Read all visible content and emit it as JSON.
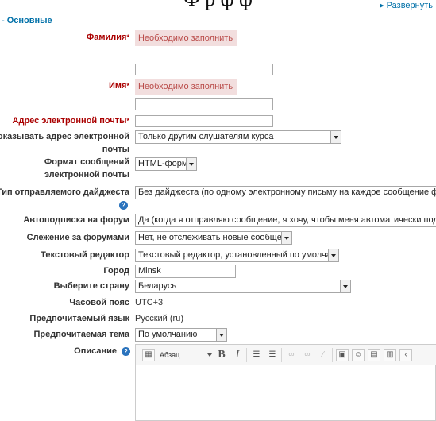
{
  "header": {
    "top_clip": "Ф р ф ф",
    "expand_link": "▸ Развернуть"
  },
  "section": {
    "legend": "- Основные"
  },
  "form": {
    "lastname": {
      "label": "Фамилия",
      "error": "Необходимо заполнить",
      "value": ""
    },
    "firstname": {
      "label": "Имя",
      "error": "Необходимо заполнить",
      "value": ""
    },
    "email": {
      "label": "Адрес электронной почты",
      "value": ""
    },
    "maildisplay": {
      "label_line1": "Показывать адрес электронной",
      "label_line2": "почты",
      "value": "Только другим слушателям курса"
    },
    "mailformat": {
      "label_line1": "Формат сообщений",
      "label_line2": "электронной почты",
      "value": "HTML-формат"
    },
    "maildigest": {
      "label": "Тип отправляемого дайджеста",
      "value": "Без дайджеста (по одному электронному письму на каждое сообщение форума)"
    },
    "autosubscribe": {
      "label": "Автоподписка на форум",
      "value": "Да (когда я отправляю сообщение, я хочу, чтобы меня автоматически подписывали"
    },
    "trackforums": {
      "label": "Слежение за форумами",
      "value": "Нет, не отслеживать новые сообщения"
    },
    "preference_htmleditor": {
      "label": "Текстовый редактор",
      "value": "Текстовый редактор, установленный по умолчанию"
    },
    "city": {
      "label": "Город",
      "value": "Minsk"
    },
    "country": {
      "label": "Выберите страну",
      "value": "Беларусь"
    },
    "timezone": {
      "label": "Часовой пояс",
      "value": "UTC+3"
    },
    "lang": {
      "label": "Предпочитаемый язык",
      "value": "Русский (ru)"
    },
    "theme": {
      "label": "Предпочитаемая тема",
      "value": "По умолчанию"
    },
    "description": {
      "label": "Описание"
    }
  },
  "editor": {
    "format_value": "Абзац"
  },
  "icons": {
    "help": "question-icon",
    "required": "asterisk-icon",
    "toolbar": [
      "toggle-toolbar-icon",
      "paragraph-format-dropdown",
      "bold-icon",
      "italic-icon",
      "unordered-list-icon",
      "ordered-list-icon",
      "link-icon",
      "unlink-icon",
      "no-autolink-icon",
      "image-icon",
      "emoticon-icon",
      "media-icon",
      "manage-files-icon",
      "more-icon"
    ]
  },
  "colors": {
    "required_label": "#aa0000",
    "error_bg": "#f2dede",
    "error_text": "#b94a48",
    "link": "#0070a8",
    "help_icon": "#2a73bd"
  }
}
